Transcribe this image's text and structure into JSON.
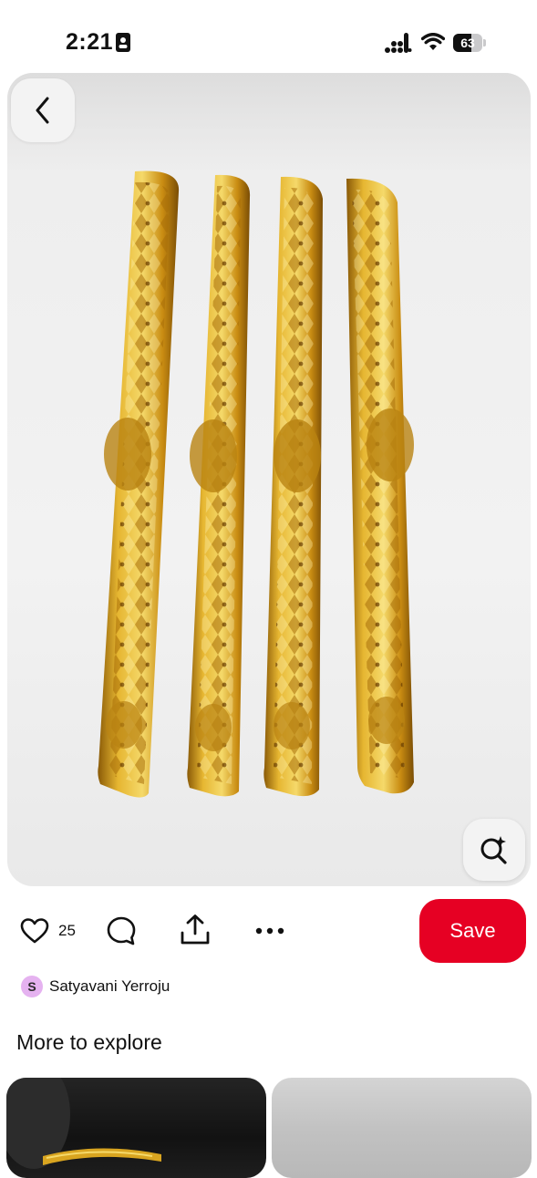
{
  "status_bar": {
    "time": "2:21",
    "battery_level": "63"
  },
  "pin": {
    "image_alt": "Gold bangles",
    "like_count": "25",
    "save_label": "Save",
    "creator": {
      "initial": "S",
      "name": "Satyavani Yerroju"
    }
  },
  "section": {
    "title": "More to explore"
  },
  "colors": {
    "save_button": "#e60023",
    "avatar_bg": "#e5b2f0",
    "gold": "#d9a520"
  },
  "icons": {
    "back": "chevron-left-icon",
    "visual_search": "lens-sparkle-icon",
    "like": "heart-icon",
    "comment": "comment-bubble-icon",
    "share": "share-upload-icon",
    "more": "ellipsis-icon"
  }
}
